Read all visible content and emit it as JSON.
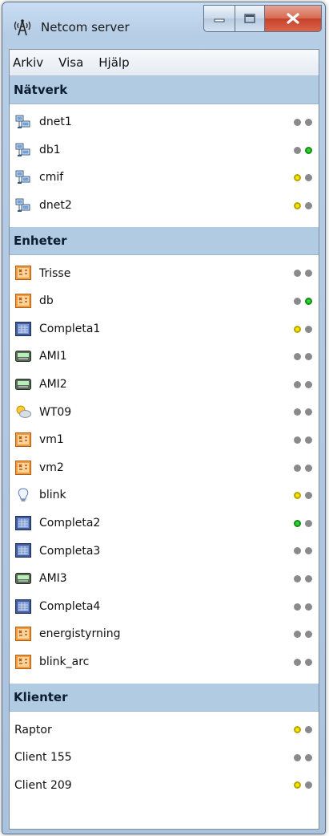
{
  "window": {
    "title": "Netcom server",
    "colors": {
      "dot_off": "#8a8a8a",
      "dot_yellow": "#f4e400",
      "dot_green": "#2bd62b",
      "header_bg": "#b0cbe2"
    }
  },
  "menu": [
    "Arkiv",
    "Visa",
    "Hjälp"
  ],
  "sections": {
    "natverk": {
      "title": "Nätverk",
      "items": [
        {
          "label": "dnet1",
          "icon": "network-icon",
          "status": [
            "off",
            "off"
          ]
        },
        {
          "label": "db1",
          "icon": "network-icon",
          "status": [
            "off",
            "green"
          ]
        },
        {
          "label": "cmif",
          "icon": "network-icon",
          "status": [
            "yellow",
            "off"
          ]
        },
        {
          "label": "dnet2",
          "icon": "network-icon",
          "status": [
            "yellow",
            "off"
          ]
        }
      ]
    },
    "enheter": {
      "title": "Enheter",
      "items": [
        {
          "label": "Trisse",
          "icon": "orange-device-icon",
          "status": [
            "off",
            "off"
          ]
        },
        {
          "label": "db",
          "icon": "orange-device-icon",
          "status": [
            "off",
            "green"
          ]
        },
        {
          "label": "Completa1",
          "icon": "completa-icon",
          "status": [
            "yellow",
            "off"
          ]
        },
        {
          "label": "AMI1",
          "icon": "ami-meter-icon",
          "status": [
            "off",
            "off"
          ]
        },
        {
          "label": "AMI2",
          "icon": "ami-meter-icon",
          "status": [
            "off",
            "off"
          ]
        },
        {
          "label": "WT09",
          "icon": "weather-icon",
          "status": [
            "off",
            "off"
          ]
        },
        {
          "label": "vm1",
          "icon": "orange-device-icon",
          "status": [
            "off",
            "off"
          ]
        },
        {
          "label": "vm2",
          "icon": "orange-device-icon",
          "status": [
            "off",
            "off"
          ]
        },
        {
          "label": "blink",
          "icon": "lightbulb-icon",
          "status": [
            "yellow",
            "off"
          ]
        },
        {
          "label": "Completa2",
          "icon": "completa-icon",
          "status": [
            "green",
            "off"
          ]
        },
        {
          "label": "Completa3",
          "icon": "completa-icon",
          "status": [
            "off",
            "off"
          ]
        },
        {
          "label": "AMI3",
          "icon": "ami-meter-icon",
          "status": [
            "off",
            "off"
          ]
        },
        {
          "label": "Completa4",
          "icon": "completa-icon",
          "status": [
            "off",
            "off"
          ]
        },
        {
          "label": "energistyrning",
          "icon": "orange-device-icon",
          "status": [
            "off",
            "off"
          ]
        },
        {
          "label": "blink_arc",
          "icon": "orange-device-icon",
          "status": [
            "off",
            "off"
          ]
        }
      ]
    },
    "klienter": {
      "title": "Klienter",
      "items": [
        {
          "label": "Raptor",
          "status": [
            "yellow",
            "off"
          ]
        },
        {
          "label": "Client 155",
          "status": [
            "off",
            "off"
          ]
        },
        {
          "label": "Client 209",
          "status": [
            "yellow",
            "off"
          ]
        }
      ]
    }
  }
}
